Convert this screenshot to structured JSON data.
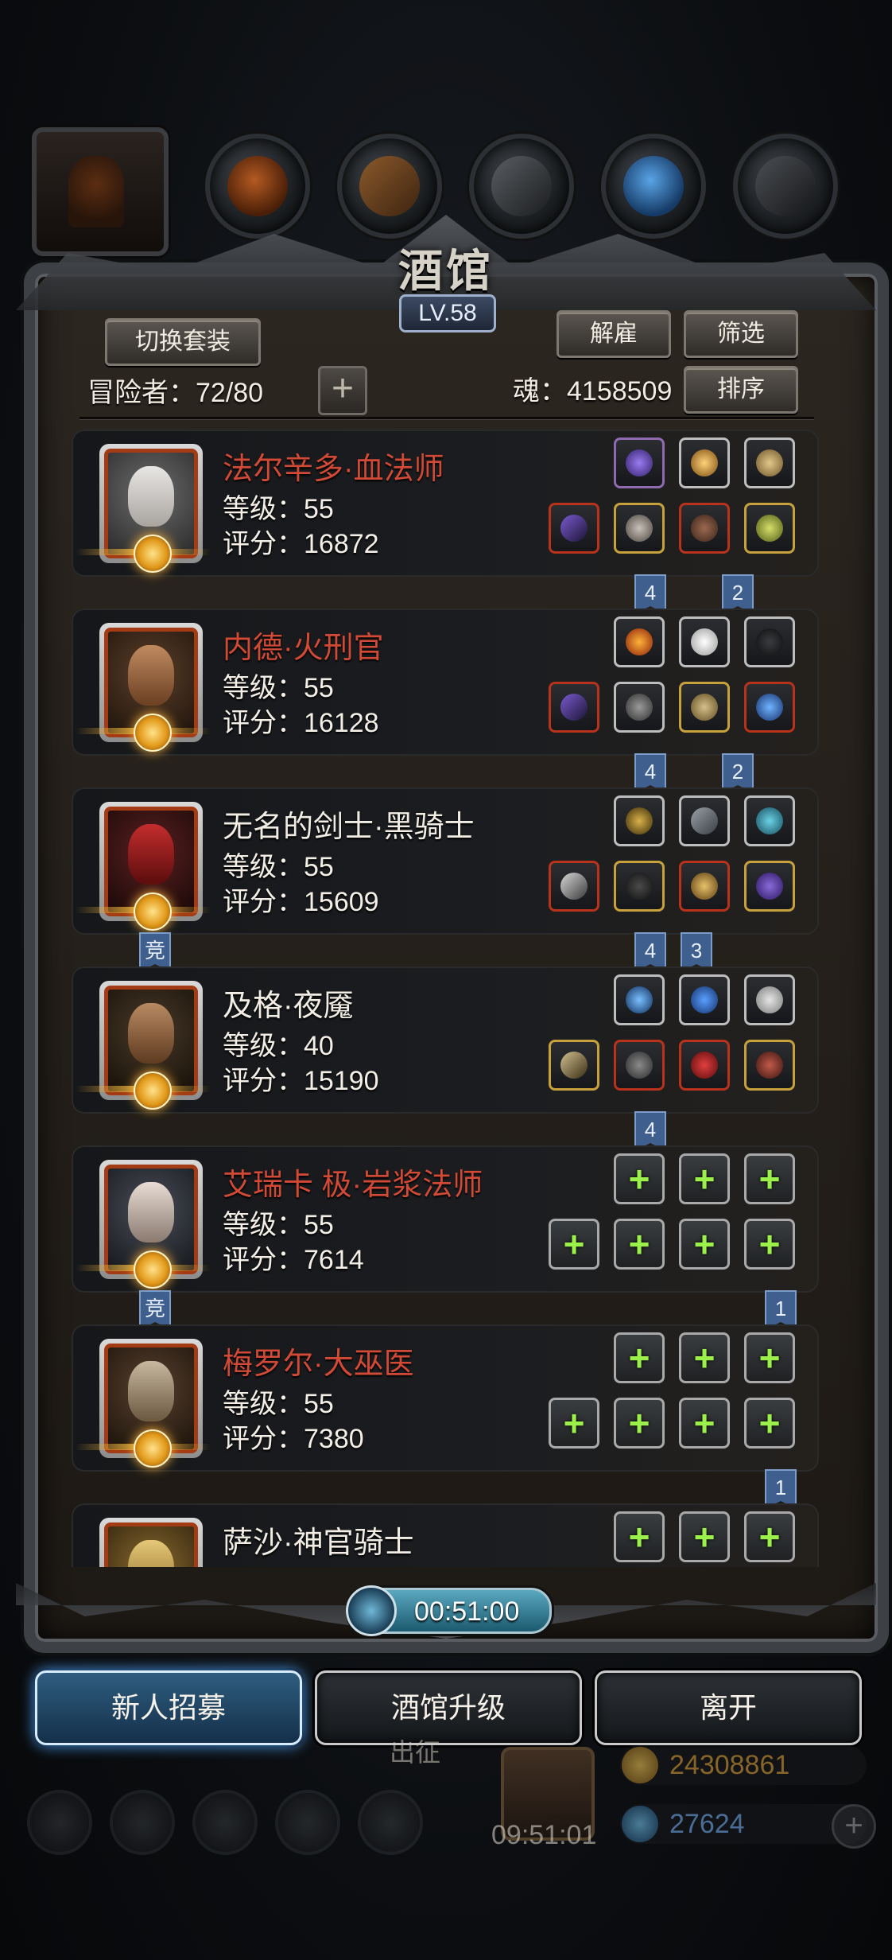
{
  "window": {
    "title": "酒馆",
    "level": "LV.58"
  },
  "header": {
    "switch_outfit": "切换套装",
    "dismiss": "解雇",
    "filter": "筛选",
    "sort": "排序",
    "adventurers": "冒险者：72/80",
    "souls": "魂：4158509",
    "add": "+"
  },
  "heroes": [
    {
      "name": "法尔辛多·血法师",
      "level": "等级：55",
      "score": "评分：16872",
      "name_color": "red",
      "tags_right": [
        "4",
        "2"
      ]
    },
    {
      "name": "内德·火刑官",
      "level": "等级：55",
      "score": "评分：16128",
      "name_color": "red",
      "tags_right": [
        "4",
        "2"
      ]
    },
    {
      "name": "无名的剑士·黑骑士",
      "level": "等级：55",
      "score": "评分：15609",
      "name_color": "white",
      "tags_right": [
        "4",
        "3"
      ],
      "tag_left": "竞"
    },
    {
      "name": "及格·夜魇",
      "level": "等级：40",
      "score": "评分：15190",
      "name_color": "white",
      "tags_right": [
        "4"
      ]
    },
    {
      "name": "艾瑞卡 极·岩浆法师",
      "level": "等级：55",
      "score": "评分：7614",
      "name_color": "red",
      "tags_right": [
        "1"
      ],
      "tag_left": "竞"
    },
    {
      "name": "梅罗尔·大巫医",
      "level": "等级：55",
      "score": "评分：7380",
      "name_color": "red",
      "tags_right": [
        "1"
      ]
    },
    {
      "name": "萨沙·神官骑士",
      "name_color": "white"
    }
  ],
  "timer": "00:51:00",
  "actions": {
    "recruit": "新人招募",
    "upgrade": "酒馆升级",
    "leave": "离开"
  },
  "footer": {
    "expedition": "出征",
    "gift_timer": "09:51:01",
    "gold": "24308861",
    "gems": "27624"
  },
  "colors": {
    "name_red": "#d24a35",
    "tag_blue": "#3f5f8f",
    "slot_plus": "#9cf04a"
  }
}
